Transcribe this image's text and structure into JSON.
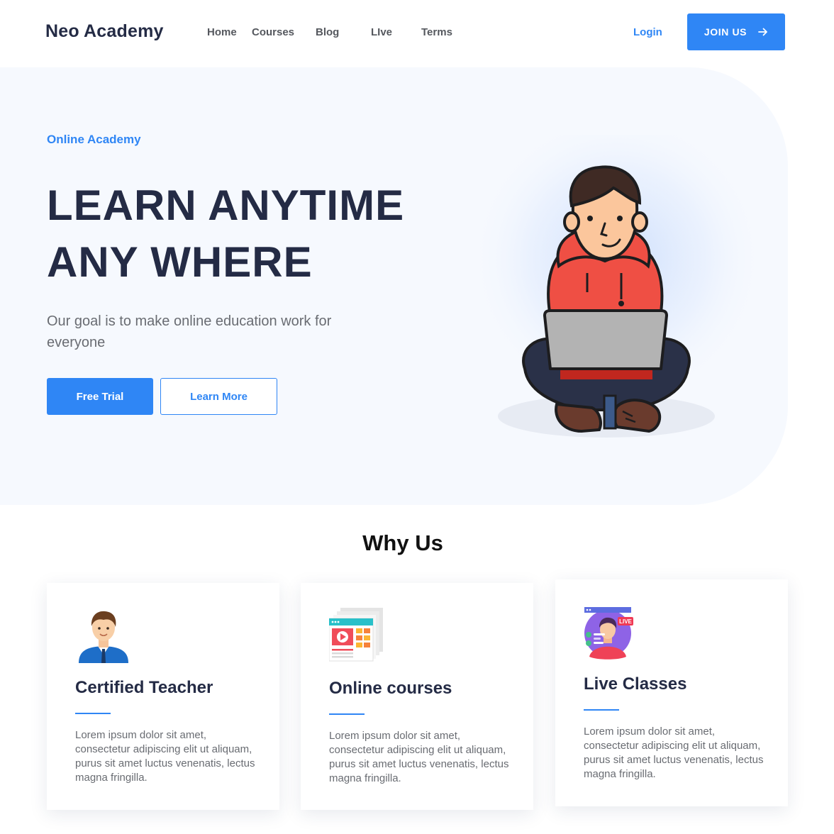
{
  "header": {
    "brand": "Neo Academy",
    "nav": [
      "Home",
      "Courses",
      "Blog",
      "LIve",
      "Terms"
    ],
    "login": "Login",
    "join": "JOIN US"
  },
  "hero": {
    "eyebrow": "Online Academy",
    "headline_line1": "LEARN ANYTIME",
    "headline_line2": "ANY WHERE",
    "subtext": "Our goal is to make online education work for everyone",
    "primary_button": "Free Trial",
    "secondary_button": "Learn More"
  },
  "why": {
    "title": "Why Us",
    "cards": [
      {
        "title": "Certified Teacher",
        "text": "Lorem ipsum dolor sit amet, consectetur adipiscing elit ut aliquam, purus sit amet luctus venenatis, lectus magna fringilla.",
        "icon": "teacher-icon"
      },
      {
        "title": "Online courses",
        "text": "Lorem ipsum dolor sit amet, consectetur adipiscing elit ut aliquam, purus sit amet luctus venenatis, lectus magna fringilla.",
        "icon": "online-course-icon"
      },
      {
        "title": "Live Classes",
        "text": "Lorem ipsum dolor sit amet, consectetur adipiscing elit ut aliquam, purus sit amet luctus venenatis, lectus magna fringilla.",
        "icon": "live-class-icon",
        "badge": "LIVE"
      }
    ]
  },
  "colors": {
    "accent": "#2f86f5",
    "heading": "#242b45",
    "body_text": "#696c72",
    "hero_bg": "#f6f9fe"
  }
}
